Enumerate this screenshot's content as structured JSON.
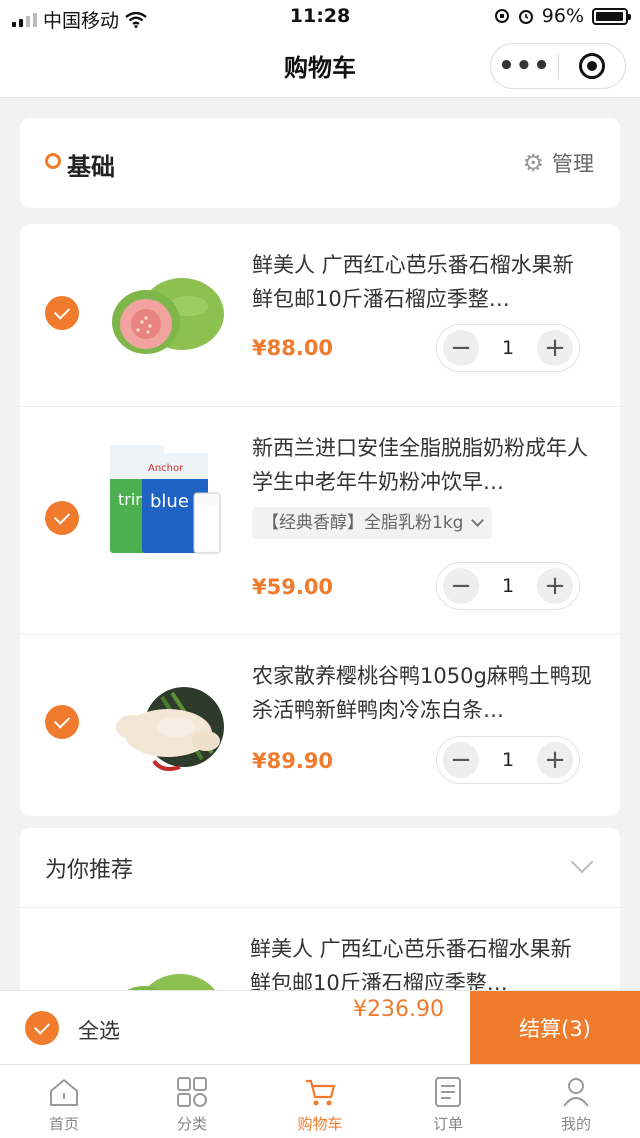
{
  "status_bar": {
    "carrier": "中国移动",
    "time": "11:28",
    "battery": "96%",
    "battery_level": 0.96
  },
  "nav": {
    "title": "购物车",
    "more_label": "•••"
  },
  "shop": {
    "name": "基础",
    "manage_label": "管理"
  },
  "items": [
    {
      "title": "鲜美人 广西红心芭乐番石榴水果新鲜包邮10斤潘石榴应季整…",
      "price": "¥88.00",
      "qty": "1",
      "selected": true,
      "sku": ""
    },
    {
      "title": "新西兰进口安佳全脂脱脂奶粉成年人学生中老年牛奶粉冲饮早…",
      "price": "¥59.00",
      "qty": "1",
      "selected": true,
      "sku": "【经典香醇】全脂乳粉1kg"
    },
    {
      "title": "农家散养樱桃谷鸭1050g麻鸭土鸭现杀活鸭新鲜鸭肉冷冻白条…",
      "price": "¥89.90",
      "qty": "1",
      "selected": true,
      "sku": ""
    }
  ],
  "recommend": {
    "title": "为你推荐",
    "first_item_title": "鲜美人 广西红心芭乐番石榴水果新鲜包邮10斤潘石榴应季整…"
  },
  "checkout": {
    "select_all_label": "全选",
    "total": "¥236.90",
    "pay_label": "结算(3)"
  },
  "tabs": [
    {
      "label": "首页",
      "icon": "home-icon",
      "active": false
    },
    {
      "label": "分类",
      "icon": "category-icon",
      "active": false
    },
    {
      "label": "购物车",
      "icon": "cart-icon",
      "active": true
    },
    {
      "label": "订单",
      "icon": "order-icon",
      "active": false
    },
    {
      "label": "我的",
      "icon": "profile-icon",
      "active": false
    }
  ],
  "colors": {
    "accent": "#f07b2d",
    "background": "#f2f2f2"
  }
}
